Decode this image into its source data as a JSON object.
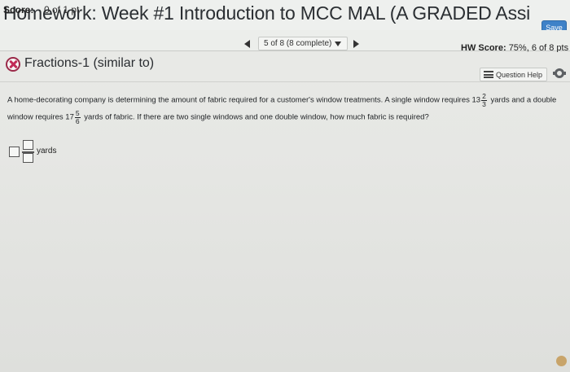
{
  "header": {
    "title": "Homework: Week #1 Introduction to MCC MAL (A GRADED Assi",
    "save_label": "Save"
  },
  "score_bar": {
    "score_label": "Score:",
    "score_value": "0 of 1 pt",
    "navigation_status": "5 of 8 (8 complete)",
    "hw_score_label": "HW Score:",
    "hw_score_value": "75%, 6 of 8 pts"
  },
  "question": {
    "status_icon": "x-circle-icon",
    "title": "Fractions-1 (similar to)",
    "help_label": "Question Help",
    "text_line1_before": "A home-decorating company is determining the amount of fabric required for a customer's window treatments. A single window requires 13",
    "fraction1_num": "2",
    "fraction1_den": "3",
    "text_line1_after": "yards and a double",
    "text_line2_before": "window requires 17",
    "fraction2_num": "5",
    "fraction2_den": "6",
    "text_line2_after": "yards of fabric. If there are two single windows and one double window, how much fabric is required?"
  },
  "answer": {
    "units": "yards"
  },
  "colors": {
    "save_button": "#3f82c8",
    "incorrect_icon": "#c22b57"
  }
}
